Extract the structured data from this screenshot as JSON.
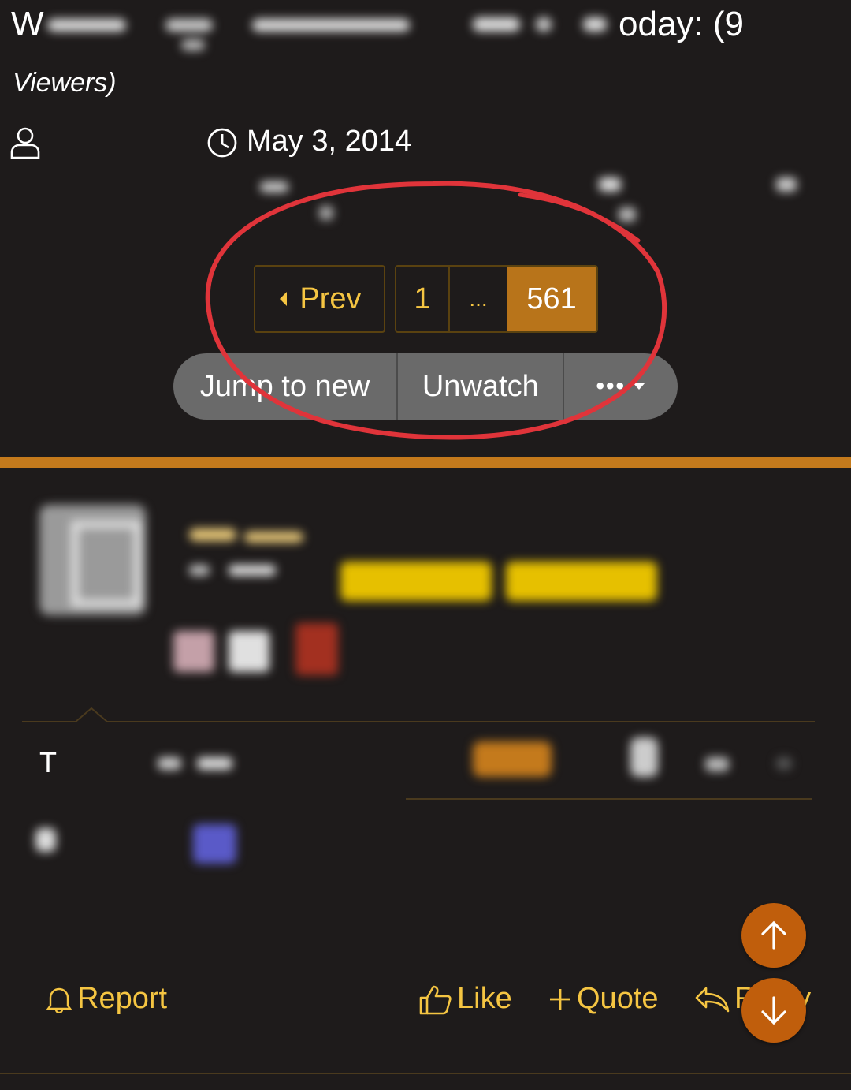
{
  "thread": {
    "title_start": "W",
    "title_end": "oday: (9",
    "title_line2": "Viewers)",
    "start_date": "May 3, 2014"
  },
  "pagination": {
    "prev_label": "Prev",
    "first_page": "1",
    "ellipsis": "...",
    "current_page": "561"
  },
  "thread_actions": {
    "jump_label": "Jump to new",
    "unwatch_label": "Unwatch",
    "more_label": "•••"
  },
  "post": {
    "text_start": "T"
  },
  "post_actions": {
    "report_label": "Report",
    "like_label": "Like",
    "quote_label": "Quote",
    "reply_label": "Reply"
  },
  "icons": {
    "prev": "caret-left-icon",
    "user": "user-icon",
    "clock": "clock-icon",
    "report": "bell-icon",
    "like": "thumbs-up-icon",
    "quote": "plus-icon",
    "reply": "reply-icon",
    "scroll_up": "arrow-up-icon",
    "scroll_down": "arrow-down-icon"
  },
  "colors": {
    "background": "#1e1b1b",
    "accent": "#c47a1c",
    "link": "#f5c542",
    "button_gray": "#6a6a6a",
    "fab": "#c05e0c",
    "annotation": "#e0343a"
  }
}
